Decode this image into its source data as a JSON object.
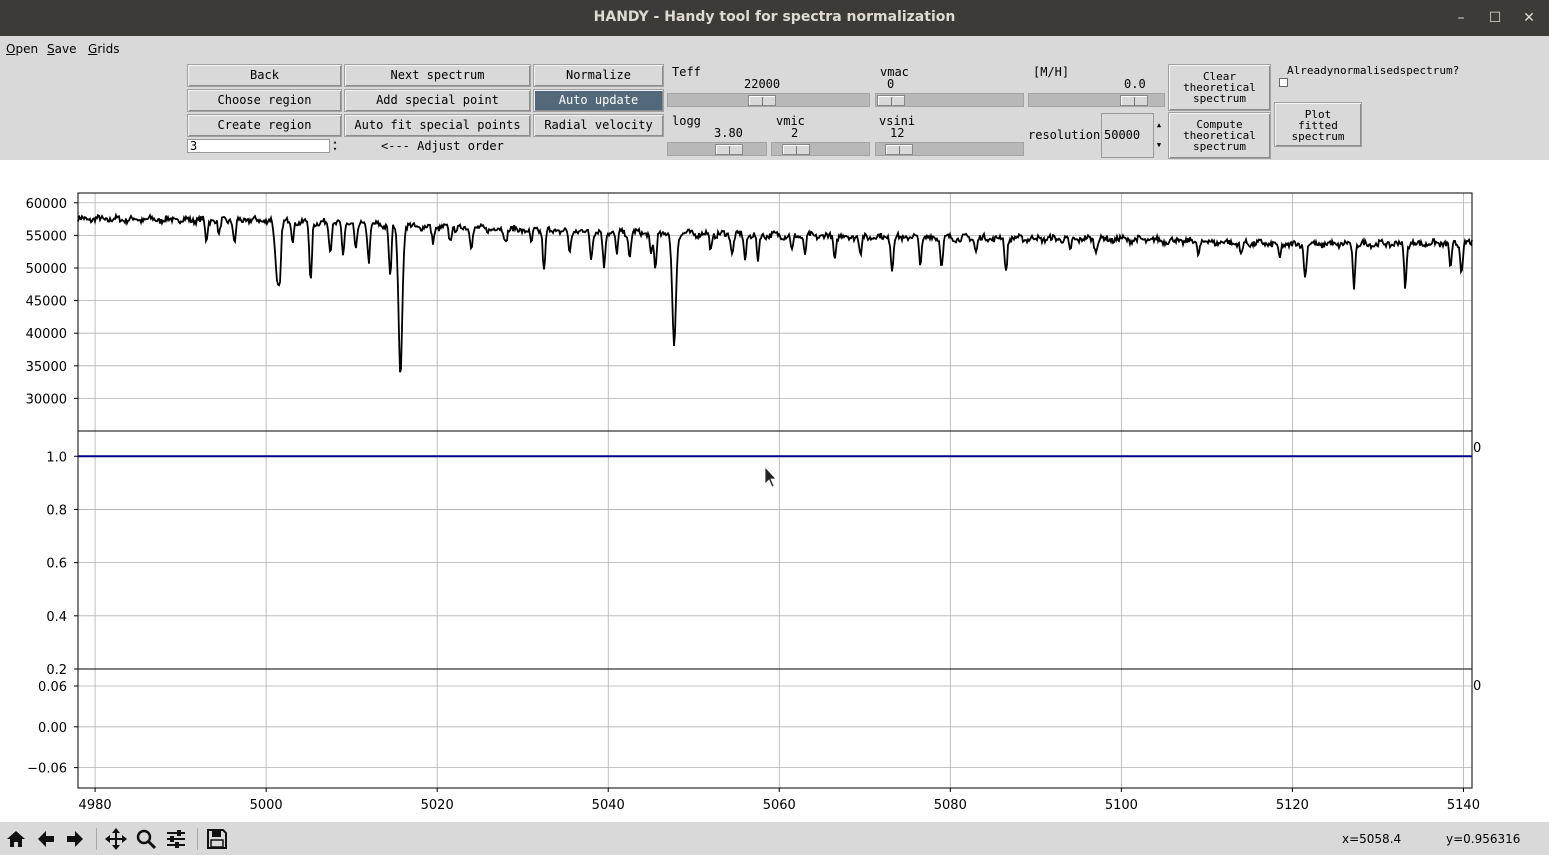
{
  "window": {
    "title": "HANDY - Handy tool for spectra normalization",
    "controls": {
      "minimize": "–",
      "maximize": "☐",
      "close": "✕"
    }
  },
  "menu": {
    "open": {
      "first": "O",
      "rest": "pen"
    },
    "save": {
      "first": "S",
      "rest": "ave"
    },
    "grids": {
      "first": "G",
      "rest": "rids"
    }
  },
  "toolbar": {
    "back": "Back",
    "choose_region": "Choose region",
    "create_region": "Create region",
    "order_value": "3",
    "next_spectrum": "Next spectrum",
    "add_special_point": "Add special point",
    "auto_fit_special_points": "Auto fit special points",
    "adjust_order": "<--- Adjust order",
    "normalize": "Normalize",
    "auto_update": "Auto update",
    "radial_velocity": "Radial velocity",
    "teff": {
      "label": "Teff",
      "value": "22000"
    },
    "vmac": {
      "label": "vmac",
      "value": "0"
    },
    "mh": {
      "label": "[M/H]",
      "value": "0.0"
    },
    "logg": {
      "label": "logg",
      "value": "3.80"
    },
    "vmic": {
      "label": "vmic",
      "value": "2"
    },
    "vsini": {
      "label": "vsini",
      "value": "12"
    },
    "resolution": {
      "label": "resolution",
      "value": "50000"
    },
    "clear_theoretical": [
      "Clear",
      "theoretical",
      "spectrum"
    ],
    "compute_theoretical": [
      "Compute",
      "theoretical",
      "spectrum"
    ],
    "already_normalised": [
      "Already",
      "normalised",
      "spectrum?"
    ],
    "plot_fitted": [
      "Plot",
      "fitted",
      "spectrum"
    ]
  },
  "status": {
    "x": "x=5058.4",
    "y": "y=0.956316"
  },
  "nav_icons": [
    "home-icon",
    "back-arrow-icon",
    "forward-arrow-icon",
    "pan-icon",
    "zoom-icon",
    "configure-subplots-icon",
    "save-figure-icon"
  ],
  "chart_data": [
    {
      "type": "line",
      "name": "observed spectrum",
      "xlim": [
        4978,
        5141
      ],
      "ylim": [
        25000,
        61500
      ],
      "yticks": [
        30000,
        35000,
        40000,
        45000,
        50000,
        55000,
        60000
      ],
      "ytick_labels": [
        "30000",
        "35000",
        "40000",
        "45000",
        "50000",
        "55000",
        "60000"
      ],
      "continuum": [
        [
          4978,
          57500
        ],
        [
          5000,
          57300
        ],
        [
          5020,
          56200
        ],
        [
          5040,
          55500
        ],
        [
          5060,
          55000
        ],
        [
          5080,
          54600
        ],
        [
          5100,
          54400
        ],
        [
          5120,
          53600
        ],
        [
          5141,
          53800
        ]
      ],
      "absorption_lines": [
        {
          "x": 4993.0,
          "depth": 3200
        },
        {
          "x": 4994.5,
          "depth": 2500
        },
        {
          "x": 4996.3,
          "depth": 3800
        },
        {
          "x": 5001.0,
          "depth": 3500
        },
        {
          "x": 5001.3,
          "depth": 8500
        },
        {
          "x": 5001.6,
          "depth": 9000
        },
        {
          "x": 5003.1,
          "depth": 3000
        },
        {
          "x": 5005.2,
          "depth": 9500
        },
        {
          "x": 5007.5,
          "depth": 4200
        },
        {
          "x": 5009.0,
          "depth": 5000
        },
        {
          "x": 5010.5,
          "depth": 4200
        },
        {
          "x": 5012.0,
          "depth": 5500
        },
        {
          "x": 5014.5,
          "depth": 8000
        },
        {
          "x": 5015.7,
          "depth": 22500
        },
        {
          "x": 5019.5,
          "depth": 2200
        },
        {
          "x": 5021.5,
          "depth": 2000
        },
        {
          "x": 5024.0,
          "depth": 2500
        },
        {
          "x": 5028.0,
          "depth": 2000
        },
        {
          "x": 5031.0,
          "depth": 2200
        },
        {
          "x": 5032.5,
          "depth": 6200
        },
        {
          "x": 5035.5,
          "depth": 3500
        },
        {
          "x": 5038.0,
          "depth": 4000
        },
        {
          "x": 5039.5,
          "depth": 5500
        },
        {
          "x": 5041.0,
          "depth": 3300
        },
        {
          "x": 5042.5,
          "depth": 4000
        },
        {
          "x": 5045.0,
          "depth": 3500
        },
        {
          "x": 5045.5,
          "depth": 5800
        },
        {
          "x": 5047.7,
          "depth": 17000
        },
        {
          "x": 5052.0,
          "depth": 2400
        },
        {
          "x": 5054.5,
          "depth": 3000
        },
        {
          "x": 5056.0,
          "depth": 3800
        },
        {
          "x": 5057.5,
          "depth": 4000
        },
        {
          "x": 5061.5,
          "depth": 2500
        },
        {
          "x": 5063.0,
          "depth": 2800
        },
        {
          "x": 5066.5,
          "depth": 3500
        },
        {
          "x": 5069.5,
          "depth": 2800
        },
        {
          "x": 5073.2,
          "depth": 5200
        },
        {
          "x": 5076.5,
          "depth": 3800
        },
        {
          "x": 5079.0,
          "depth": 4300
        },
        {
          "x": 5083.0,
          "depth": 2000
        },
        {
          "x": 5086.5,
          "depth": 5200
        },
        {
          "x": 5094.0,
          "depth": 2000
        },
        {
          "x": 5097.0,
          "depth": 1800
        },
        {
          "x": 5109.0,
          "depth": 1800
        },
        {
          "x": 5114.0,
          "depth": 2000
        },
        {
          "x": 5118.5,
          "depth": 2500
        },
        {
          "x": 5121.5,
          "depth": 5000
        },
        {
          "x": 5127.2,
          "depth": 6500
        },
        {
          "x": 5133.2,
          "depth": 6500
        },
        {
          "x": 5138.5,
          "depth": 4000
        },
        {
          "x": 5139.8,
          "depth": 4500
        }
      ]
    },
    {
      "type": "line",
      "name": "normalized spectrum",
      "xlim": [
        4978,
        5141
      ],
      "ylim": [
        0.2,
        1.095
      ],
      "yticks": [
        0.2,
        0.4,
        0.6,
        0.8,
        1.0
      ],
      "ytick_labels": [
        "0.2",
        "0.4",
        "0.6",
        "0.8",
        "1.0"
      ],
      "line_y": 1.0,
      "line_color": "#00008b",
      "corner_label": "0"
    },
    {
      "type": "line",
      "name": "residuals",
      "xlim": [
        4978,
        5141
      ],
      "ylim": [
        -0.09,
        0.085
      ],
      "yticks": [
        -0.06,
        0.0,
        0.06
      ],
      "ytick_labels": [
        "−0.06",
        "0.00",
        "0.06"
      ],
      "xticks": [
        4980,
        5000,
        5020,
        5040,
        5060,
        5080,
        5100,
        5120,
        5140
      ],
      "xtick_labels": [
        "4980",
        "5000",
        "5020",
        "5040",
        "5060",
        "5080",
        "5100",
        "5120",
        "5140"
      ],
      "corner_label": "0"
    }
  ]
}
